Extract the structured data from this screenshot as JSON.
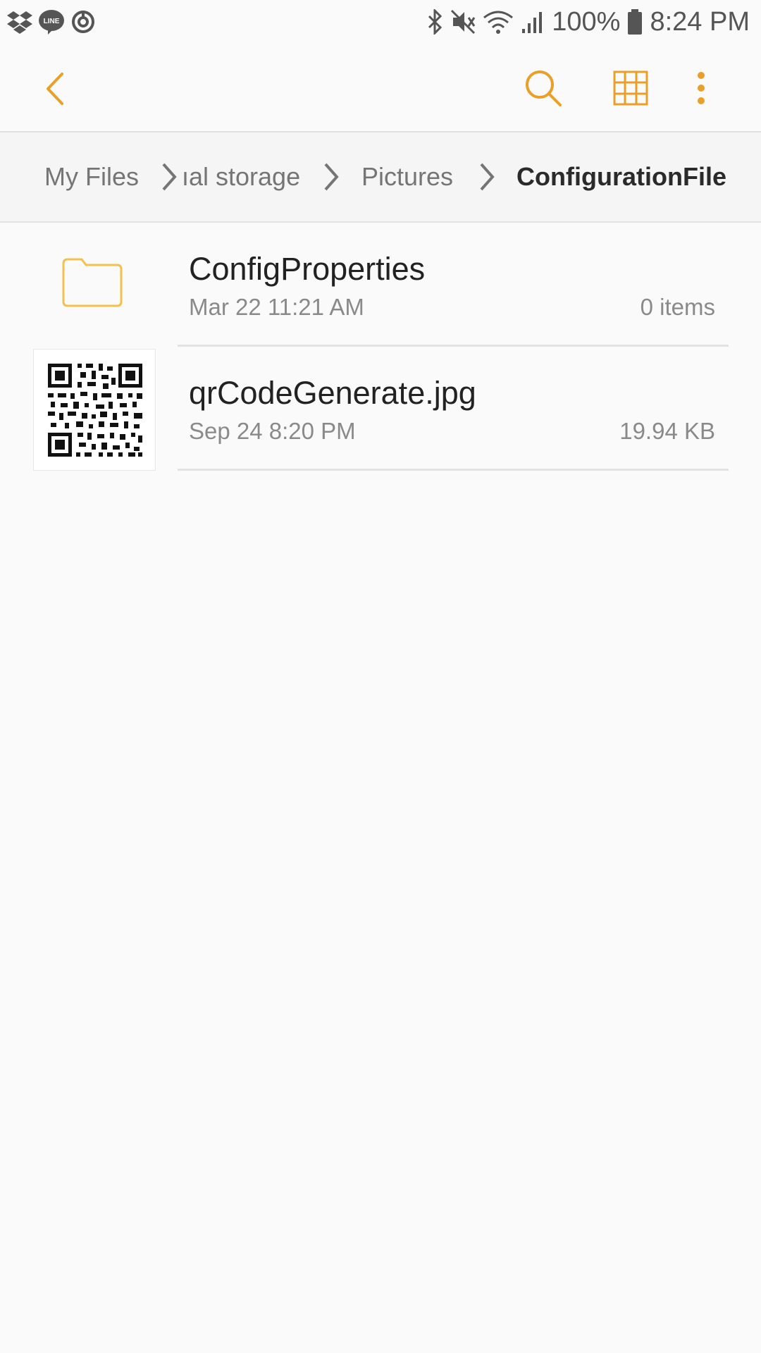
{
  "status_bar": {
    "battery": "100%",
    "time": "8:24 PM",
    "icons": [
      "dropbox-icon",
      "line-icon",
      "sync-icon",
      "bluetooth-icon",
      "mute-icon",
      "wifi-icon",
      "signal-icon",
      "battery-icon"
    ]
  },
  "toolbar": {
    "back_icon": "chevron-left-icon",
    "search_icon": "search-icon",
    "grid_icon": "grid-view-icon",
    "more_icon": "more-vert-icon",
    "accent_color": "#e8a02a"
  },
  "breadcrumb": {
    "items": [
      {
        "label": "My Files"
      },
      {
        "label": "ıal storage"
      },
      {
        "label": "Pictures"
      },
      {
        "label": "ConfigurationFile"
      }
    ]
  },
  "files": [
    {
      "name": "ConfigProperties",
      "date": "Mar 22 11:21 AM",
      "meta": "0 items",
      "type": "folder-icon"
    },
    {
      "name": "qrCodeGenerate.jpg",
      "date": "Sep 24 8:20 PM",
      "meta": "19.94 KB",
      "type": "qr-thumbnail"
    }
  ]
}
